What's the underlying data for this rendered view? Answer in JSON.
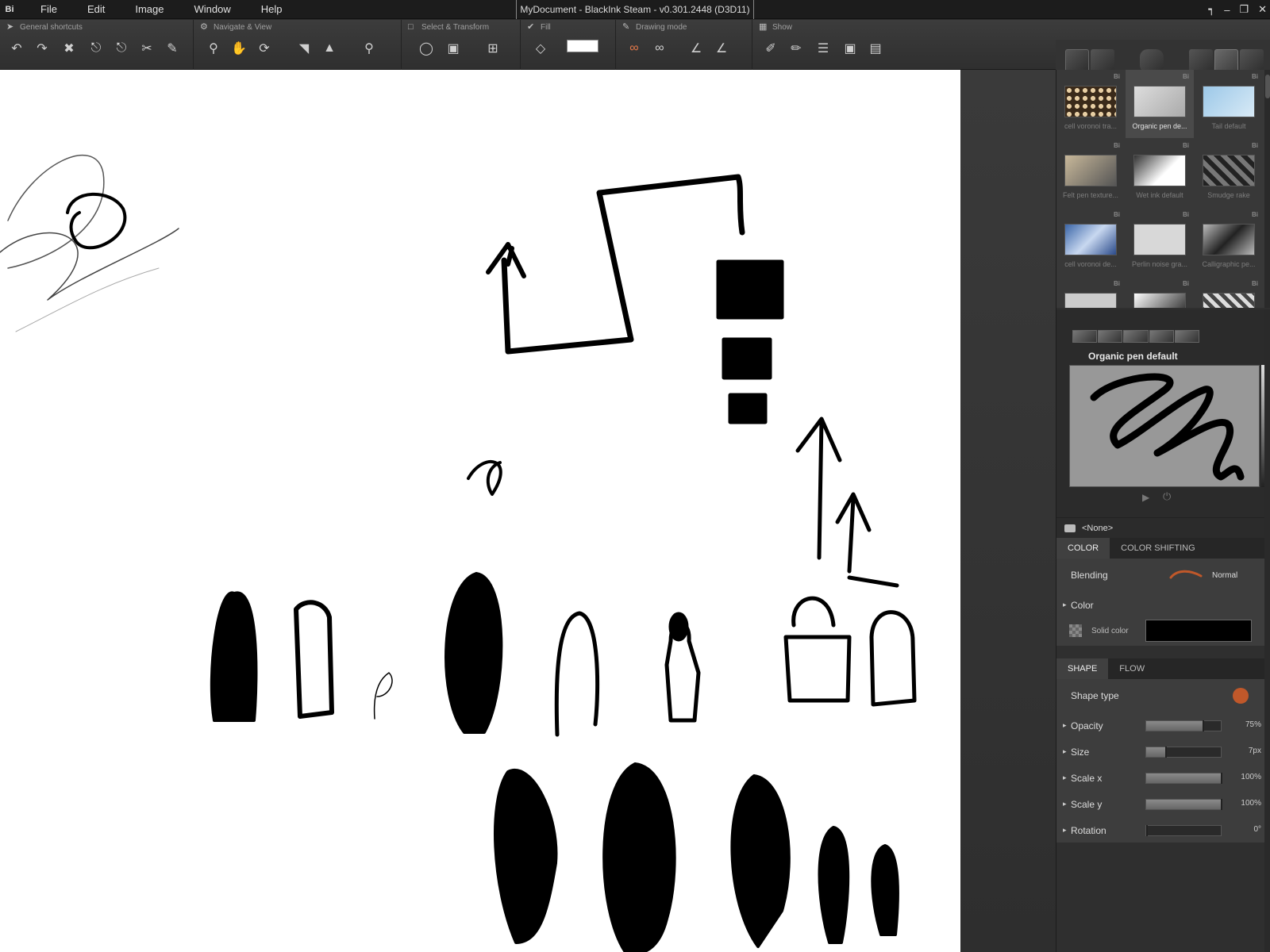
{
  "titlebar": {
    "logo": "Bi",
    "menu": [
      "File",
      "Edit",
      "Image",
      "Window",
      "Help"
    ],
    "title": "MyDocument - BlackInk Steam - v0.301.2448 (D3D11)"
  },
  "toolbar": {
    "groups": {
      "general": "General shortcuts",
      "navigate": "Navigate & View",
      "select": "Select & Transform",
      "fill": "Fill",
      "drawing": "Drawing mode",
      "show": "Show"
    }
  },
  "presets": {
    "items": [
      {
        "label": "cell voronoi tra...",
        "badge": "Bi"
      },
      {
        "label": "Organic pen de...",
        "badge": "Bi"
      },
      {
        "label": "Tail default",
        "badge": "Bi"
      },
      {
        "label": "Felt pen texture...",
        "badge": "Bi"
      },
      {
        "label": "Wet ink default",
        "badge": "Bi"
      },
      {
        "label": "Smudge rake",
        "badge": "Bi"
      },
      {
        "label": "cell voronoi de...",
        "badge": "Bi"
      },
      {
        "label": "Perlin noise gra...",
        "badge": "Bi"
      },
      {
        "label": "Calligraphic pe...",
        "badge": "Bi"
      },
      {
        "label": "",
        "badge": "Bi"
      },
      {
        "label": "",
        "badge": "Bi"
      },
      {
        "label": "",
        "badge": "Bi"
      }
    ],
    "selected_name": "Organic pen default",
    "stamp": "<None>"
  },
  "color_section": {
    "tabs": [
      "COLOR",
      "COLOR SHIFTING"
    ],
    "blending_label": "Blending",
    "blending_value": "Normal",
    "color_label": "Color",
    "solid_label": "Solid color",
    "solid_value": "#000000"
  },
  "shape_section": {
    "tabs": [
      "SHAPE",
      "FLOW"
    ],
    "shape_type_label": "Shape type",
    "shape_color": "#c0582a",
    "params": [
      {
        "label": "Opacity",
        "value": "75%",
        "level": 0.75
      },
      {
        "label": "Size",
        "value": "7px",
        "level": 0.25
      },
      {
        "label": "Scale x",
        "value": "100%",
        "level": 1.0
      },
      {
        "label": "Scale y",
        "value": "100%",
        "level": 1.0
      },
      {
        "label": "Rotation",
        "value": "0°",
        "level": 0.0
      }
    ]
  },
  "colors": {
    "accent": "#c0582a",
    "canvas": "#ffffff"
  }
}
